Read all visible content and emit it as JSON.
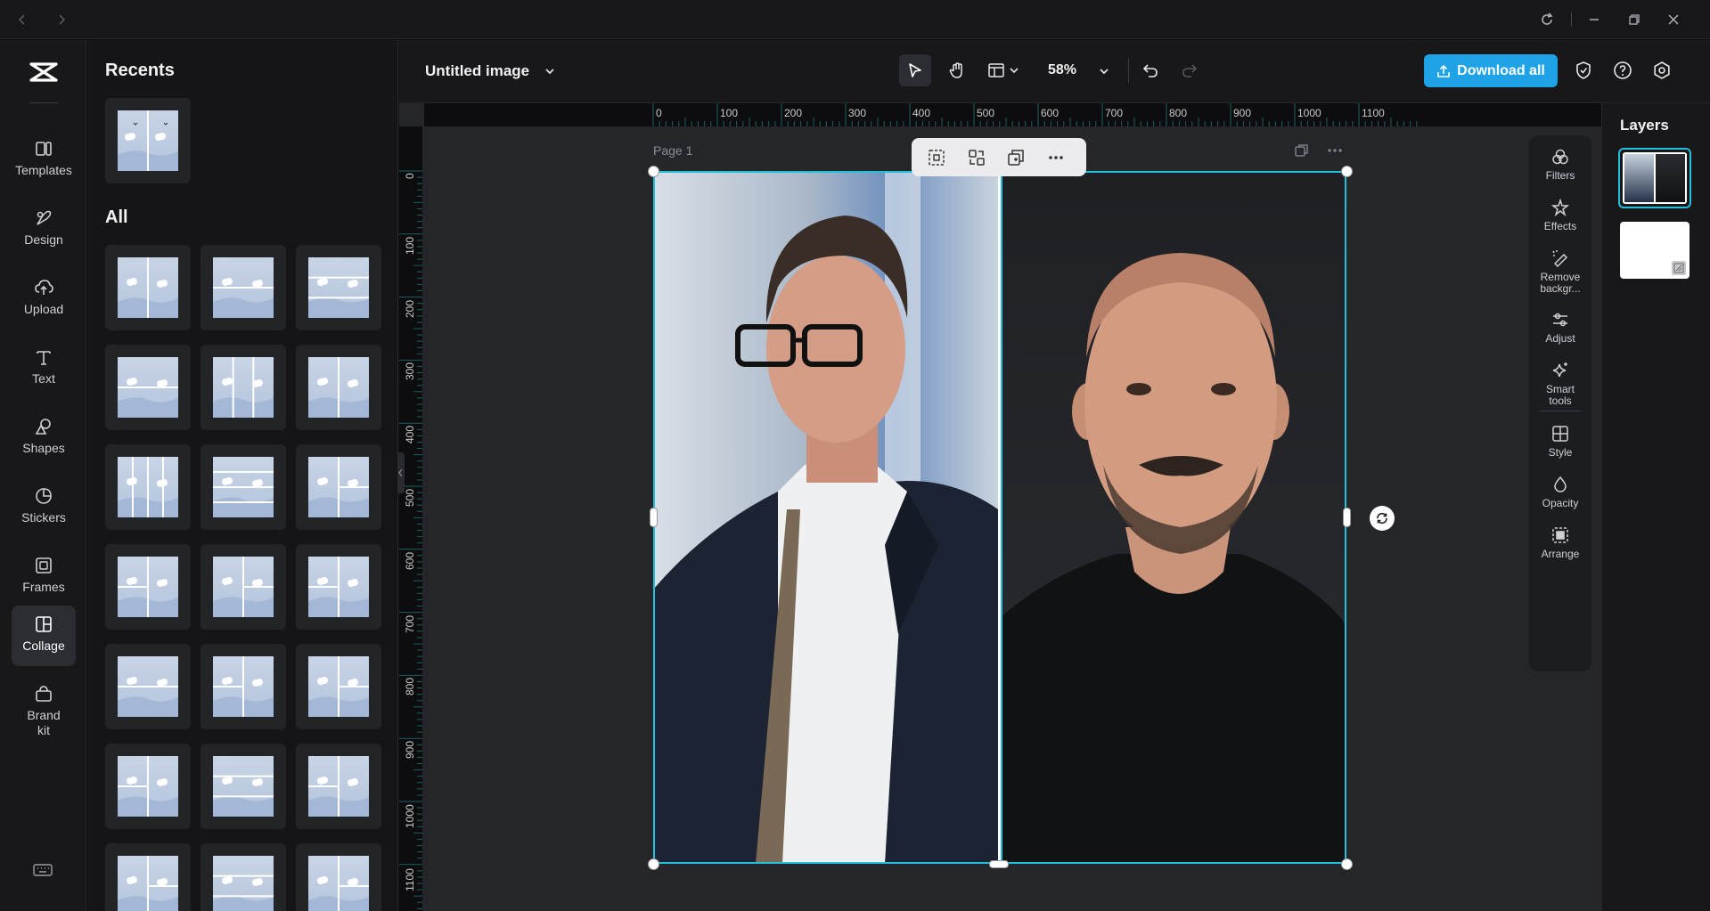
{
  "document": {
    "title": "Untitled image",
    "page_label": "Page 1"
  },
  "toolbar": {
    "zoom": "58%",
    "download_label": "Download all"
  },
  "rail": {
    "items": [
      {
        "label": "Templates",
        "icon": "templates-icon"
      },
      {
        "label": "Design",
        "icon": "design-icon"
      },
      {
        "label": "Upload",
        "icon": "upload-icon"
      },
      {
        "label": "Text",
        "icon": "text-icon"
      },
      {
        "label": "Shapes",
        "icon": "shapes-icon"
      },
      {
        "label": "Stickers",
        "icon": "stickers-icon"
      },
      {
        "label": "Frames",
        "icon": "frames-icon"
      },
      {
        "label": "Collage",
        "icon": "collage-icon",
        "active": true
      },
      {
        "label": "Brand\nkit",
        "icon": "brand-kit-icon"
      }
    ]
  },
  "panel": {
    "recents_title": "Recents",
    "all_title": "All"
  },
  "ruler": {
    "top": [
      "0",
      "100",
      "200",
      "300",
      "400",
      "500",
      "600",
      "700",
      "800",
      "900",
      "1000",
      "1100"
    ],
    "left": [
      "0",
      "100",
      "200",
      "300",
      "400",
      "500",
      "600",
      "700",
      "800",
      "900",
      "1000",
      "1100"
    ]
  },
  "tools": [
    {
      "label": "Filters",
      "icon": "filters-icon"
    },
    {
      "label": "Effects",
      "icon": "effects-icon"
    },
    {
      "label": "Remove\nbackgr...",
      "icon": "remove-background-icon"
    },
    {
      "label": "Adjust",
      "icon": "adjust-icon"
    },
    {
      "label": "Smart\ntools",
      "icon": "smart-tools-icon"
    },
    {
      "label": "Style",
      "icon": "style-icon"
    },
    {
      "label": "Opacity",
      "icon": "opacity-icon"
    },
    {
      "label": "Arrange",
      "icon": "arrange-icon"
    }
  ],
  "layers": {
    "title": "Layers"
  },
  "colors": {
    "accent": "#1fa3e8",
    "selection": "#22c0dc",
    "active_bg": "#2b2d33"
  }
}
